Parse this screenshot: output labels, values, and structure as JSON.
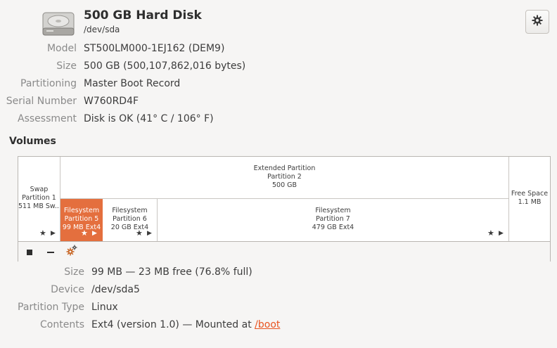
{
  "header": {
    "title": "500 GB Hard Disk",
    "device_path": "/dev/sda",
    "icon": "hard-disk-icon",
    "settings_icon": "gear-icon"
  },
  "properties": [
    {
      "label": "Model",
      "value": "ST500LM000-1EJ162 (DEM9)"
    },
    {
      "label": "Size",
      "value": "500 GB (500,107,862,016 bytes)"
    },
    {
      "label": "Partitioning",
      "value": "Master Boot Record"
    },
    {
      "label": "Serial Number",
      "value": "W760RD4F"
    },
    {
      "label": "Assessment",
      "value": "Disk is OK (41° C / 106° F)"
    }
  ],
  "volumes": {
    "heading": "Volumes",
    "swap": {
      "line1": "Swap",
      "line2": "Partition 1",
      "line3": "511 MB Sw..."
    },
    "extended": {
      "line1": "Extended Partition",
      "line2": "Partition 2",
      "line3": "500 GB"
    },
    "p5": {
      "line1": "Filesystem",
      "line2": "Partition 5",
      "line3": "99 MB Ext4",
      "selected": true
    },
    "p6": {
      "line1": "Filesystem",
      "line2": "Partition 6",
      "line3": "20 GB Ext4"
    },
    "p7": {
      "line1": "Filesystem",
      "line2": "Partition 7",
      "line3": "479 GB Ext4"
    },
    "free": {
      "line1": "Free Space",
      "line2": "1.1 MB"
    },
    "colors": {
      "selected": "#e46f3e",
      "accent": "#e95420"
    },
    "toolbar": {
      "stop_icon": "stop-icon",
      "remove_icon": "minus-icon",
      "options_icon": "gears-icon"
    }
  },
  "details": {
    "size": {
      "label": "Size",
      "value": "99 MB — 23 MB free (76.8% full)"
    },
    "device": {
      "label": "Device",
      "value": "/dev/sda5"
    },
    "partition_type": {
      "label": "Partition Type",
      "value": "Linux"
    },
    "contents": {
      "label": "Contents",
      "value_prefix": "Ext4 (version 1.0) — Mounted at ",
      "mount_link": "/boot"
    }
  }
}
